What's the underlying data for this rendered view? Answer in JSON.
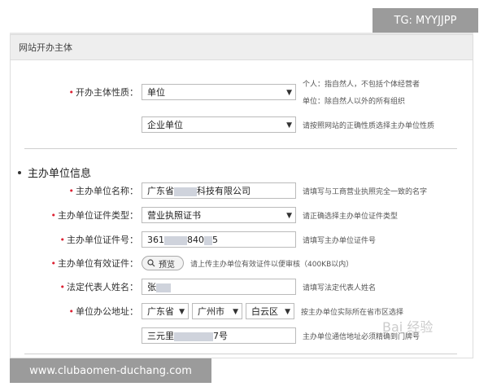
{
  "overlay": {
    "tg": "TG: MYYJJPP",
    "url": "www.clubaomen-duchang.com",
    "watermark": "Bai 经验"
  },
  "section1": {
    "header": "网站开办主体",
    "nature_label": "开办主体性质：",
    "nature_value": "单位",
    "nature_hint_1": "个人：指自然人，不包括个体经营者",
    "nature_hint_2": "单位：除自然人以外的所有组织",
    "org_type_value": "企业单位",
    "org_type_hint": "请按照网站的正确性质选择主办单位性质"
  },
  "section2": {
    "title": "主办单位信息",
    "name_label": "主办单位名称：",
    "name_value_prefix": "广东省",
    "name_value_suffix": "科技有限公司",
    "name_hint": "请填写与工商营业执照完全一致的名字",
    "cert_type_label": "主办单位证件类型：",
    "cert_type_value": "营业执照证书",
    "cert_type_hint": "请正确选择主办单位证件类型",
    "cert_no_label": "主办单位证件号：",
    "cert_no_prefix": "361",
    "cert_no_mid": "840",
    "cert_no_suffix": "5",
    "cert_no_hint": "请填写主办单位证件号",
    "cert_upload_label": "主办单位有效证件：",
    "preview_button": "预览",
    "cert_upload_hint": "请上传主办单位有效证件以便审核（400KB以内）",
    "legal_label": "法定代表人姓名：",
    "legal_value": "张",
    "legal_hint": "请填写法定代表人姓名",
    "address_label": "单位办公地址：",
    "province": "广东省",
    "city": "广州市",
    "district": "白云区",
    "address_hint": "按主办单位实际所在省市区选择",
    "street_prefix": "三元里",
    "street_suffix": "7号",
    "street_hint": "主办单位通信地址必须精确到门牌号"
  }
}
